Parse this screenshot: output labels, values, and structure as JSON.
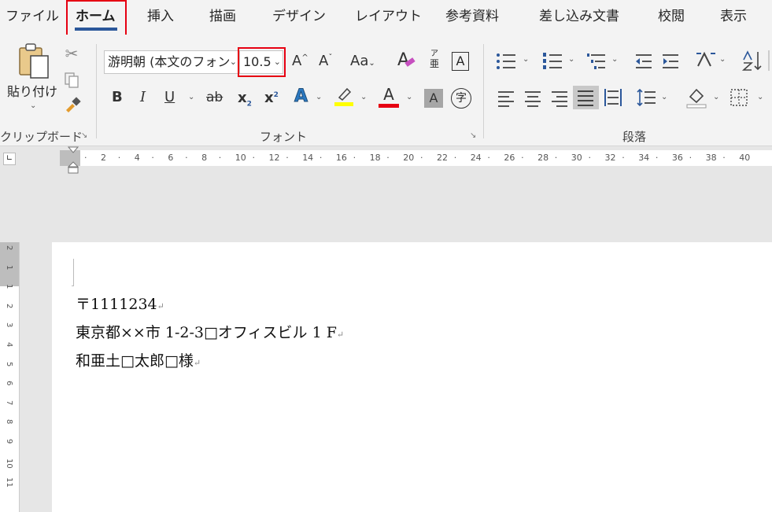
{
  "tabs": [
    "ファイル",
    "ホーム",
    "挿入",
    "描画",
    "デザイン",
    "レイアウト",
    "参考資料",
    "差し込み文書",
    "校閲",
    "表示"
  ],
  "clipboard": {
    "paste_label": "貼り付け",
    "group_label": "クリップボード"
  },
  "font": {
    "name_value": "游明朝 (本文のフォン",
    "size_value": "10.5",
    "group_label": "フォント",
    "grow_label": "A",
    "shrink_label": "A",
    "case_label": "Aa",
    "phonetic_top": "ア",
    "phonetic_bottom": "亜",
    "border_char": "A",
    "bold": "B",
    "italic": "I",
    "underline": "U",
    "strike": "ab",
    "subscript": "x",
    "superscript": "x",
    "effects": "A",
    "color_char": "A",
    "shading_char": "A",
    "enclose_char": "字",
    "highlight_color": "#ffff00",
    "font_color": "#e60012"
  },
  "paragraph": {
    "group_label": "段落"
  },
  "ruler": {
    "ticks": [
      "2",
      "4",
      "6",
      "8",
      "10",
      "12",
      "14",
      "16",
      "18",
      "20",
      "22",
      "24",
      "26",
      "28",
      "30",
      "32",
      "34",
      "36",
      "38",
      "40"
    ],
    "vticks": [
      "2",
      "1",
      "1",
      "2",
      "3",
      "4",
      "5",
      "6",
      "7",
      "8",
      "9",
      "10",
      "11"
    ]
  },
  "document": {
    "lines": [
      "〒1111234",
      "東京都××市 1-2-3□オフィスビル 1 F",
      "和亜土□太郎□様"
    ]
  },
  "colors": {
    "accent": "#2b579a",
    "highlight_box": "#e60012"
  }
}
